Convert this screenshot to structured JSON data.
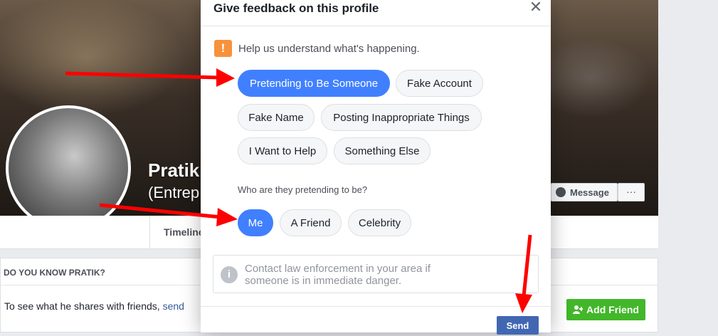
{
  "profile": {
    "name_visible": "Pratik",
    "subtitle_visible": "(Entrep",
    "message_button": "Message",
    "more_button": "···",
    "tab_timeline": "Timeline",
    "know_title": "DO YOU KNOW PRATIK?",
    "know_text": "To see what he shares with friends, ",
    "know_link": "send",
    "add_friend": "Add Friend"
  },
  "modal": {
    "title": "Give feedback on this profile",
    "close_glyph": "✕",
    "help_icon_glyph": "!",
    "help_text": "Help us understand what's happening.",
    "reasons": [
      {
        "label": "Pretending to Be Someone",
        "selected": true
      },
      {
        "label": "Fake Account",
        "selected": false
      },
      {
        "label": "Fake Name",
        "selected": false
      },
      {
        "label": "Posting Inappropriate Things",
        "selected": false
      },
      {
        "label": "I Want to Help",
        "selected": false
      },
      {
        "label": "Something Else",
        "selected": false
      }
    ],
    "question": "Who are they pretending to be?",
    "targets": [
      {
        "label": "Me",
        "selected": true
      },
      {
        "label": "A Friend",
        "selected": false
      },
      {
        "label": "Celebrity",
        "selected": false
      }
    ],
    "info_icon_glyph": "i",
    "info_text": "Contact law enforcement in your area if someone is in immediate danger.",
    "send_button": "Send"
  },
  "colors": {
    "selected_pill": "#4080ff",
    "send_button": "#4267b2",
    "alert_icon": "#f7923b",
    "add_friend": "#42b72a",
    "annotation_arrow": "#ff0000"
  },
  "icons": [
    "alert-icon",
    "close-icon",
    "info-icon",
    "messenger-icon",
    "add-friend-icon"
  ]
}
